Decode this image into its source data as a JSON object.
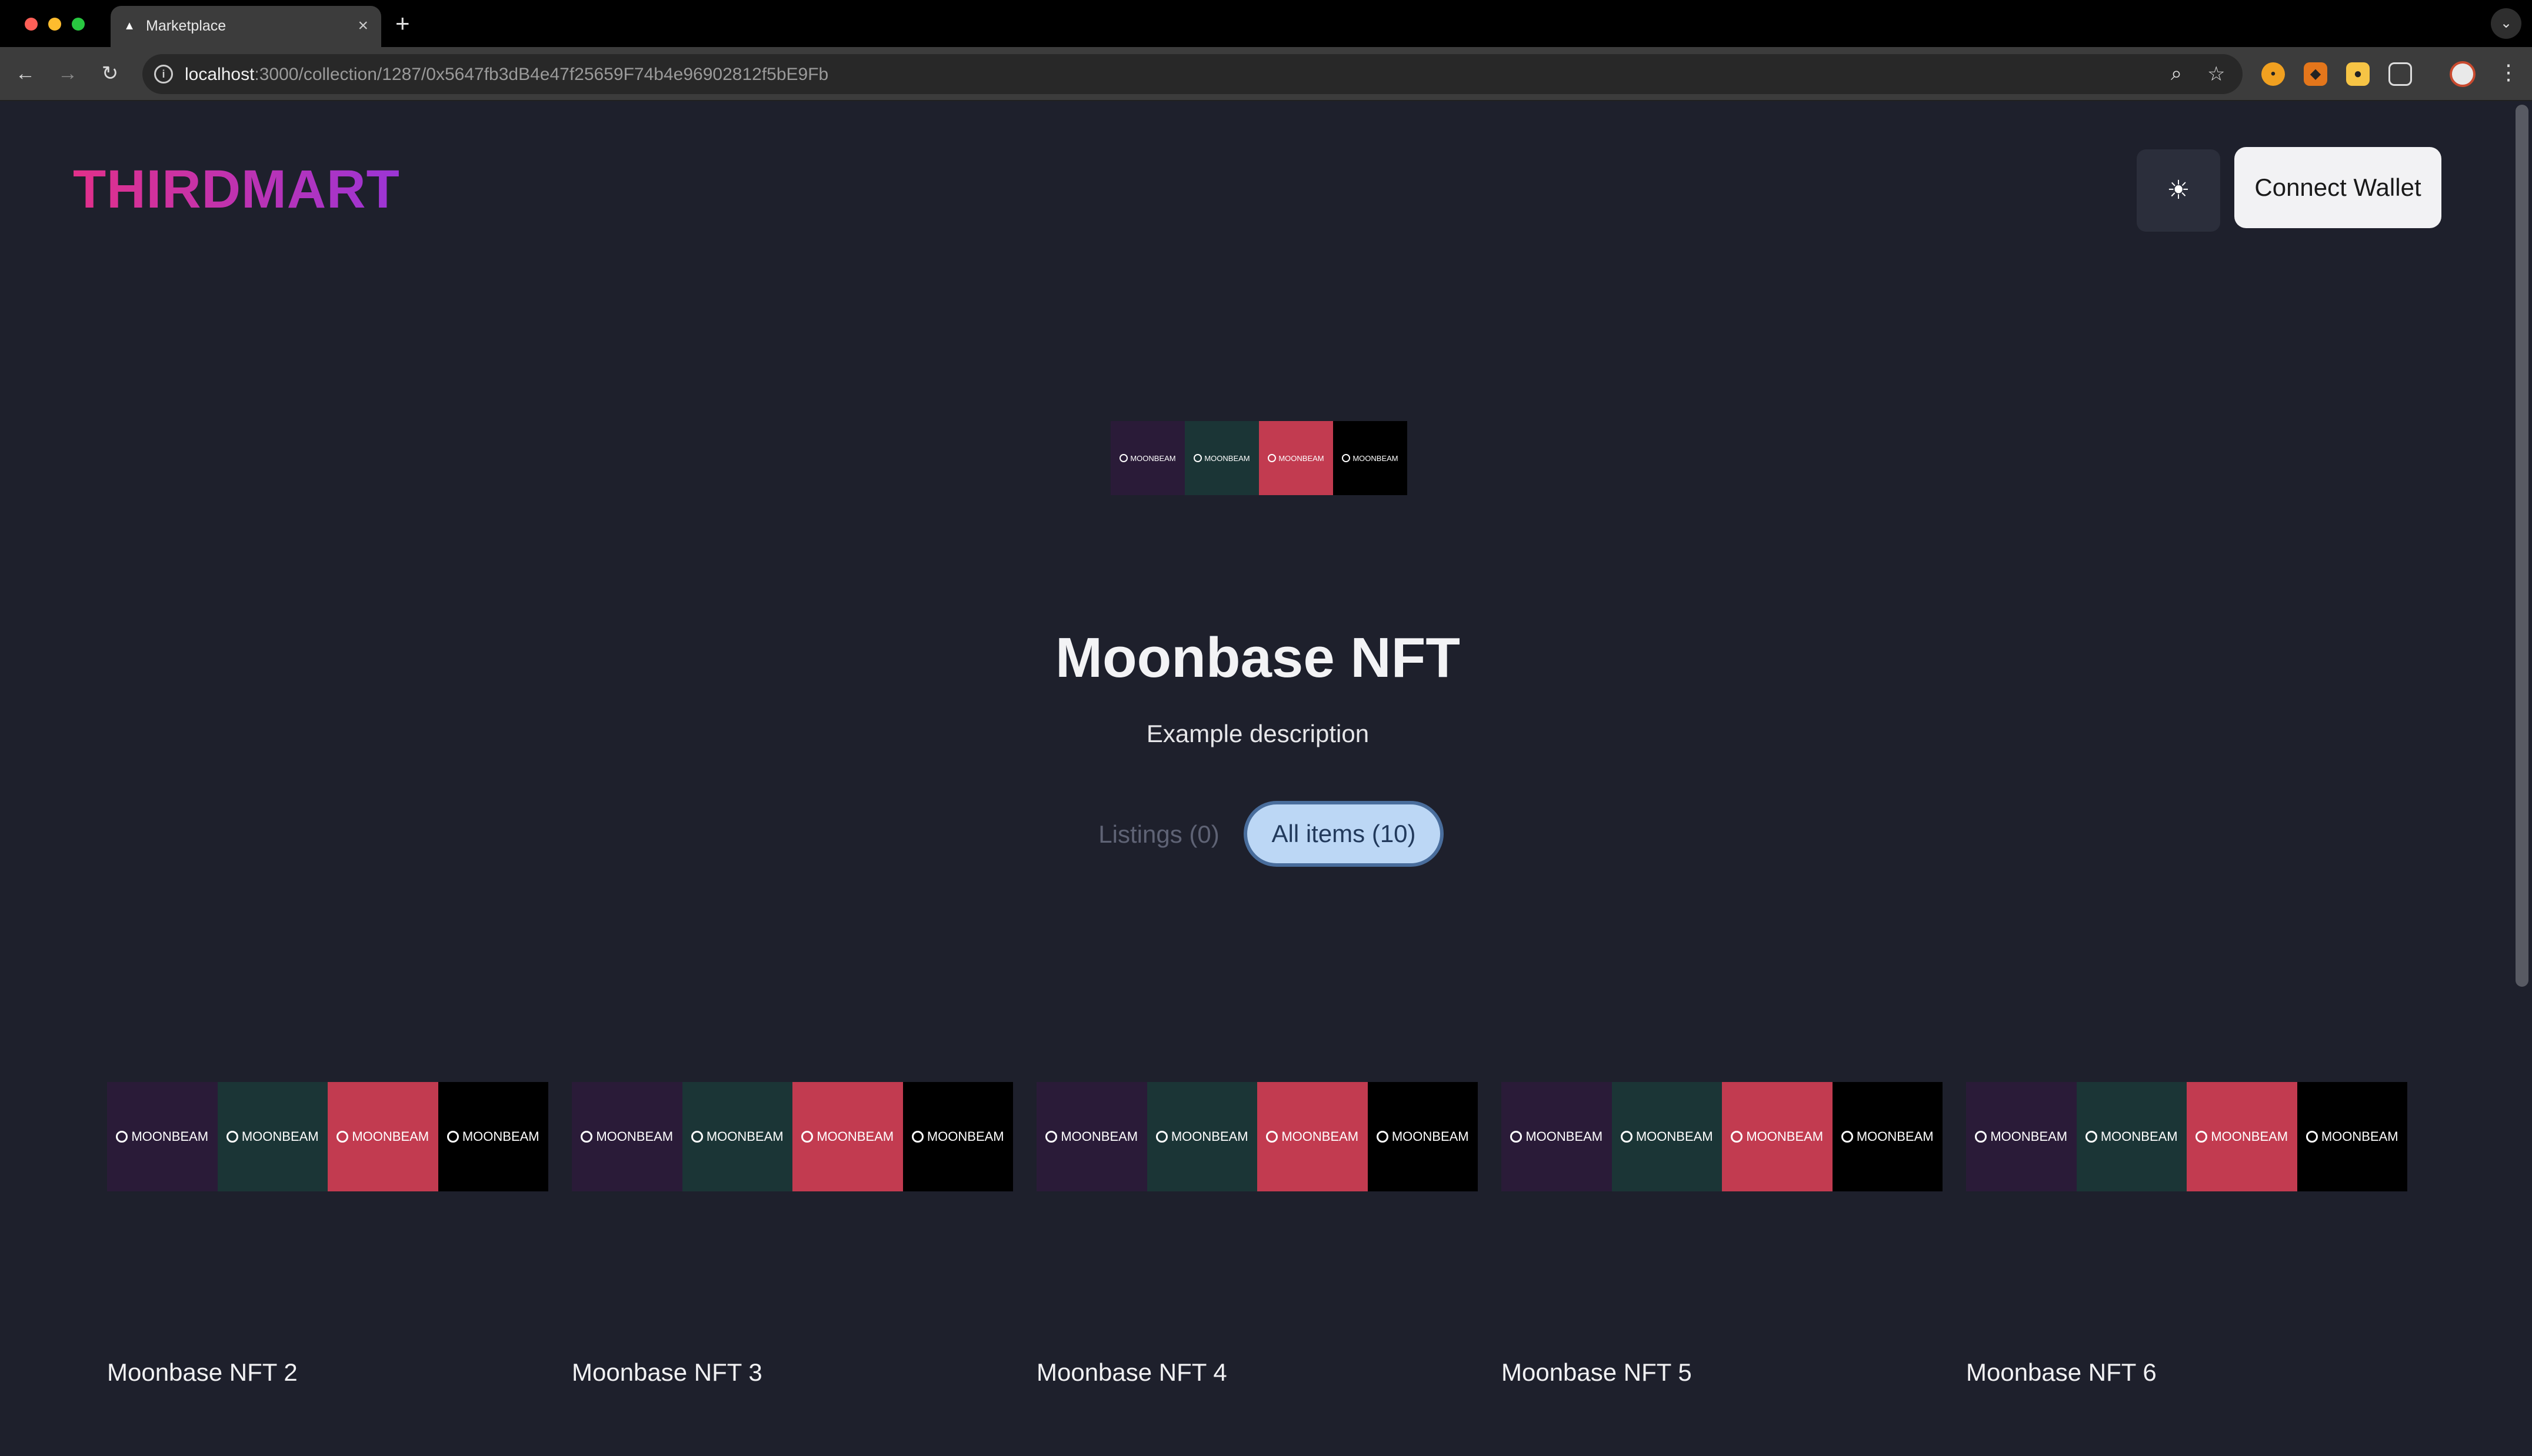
{
  "browser": {
    "tab_title": "Marketplace",
    "tab_favicon": "triangle-icon",
    "url_host": "localhost",
    "url_path": ":3000/collection/1287/0x5647fb3dB4e47f25659F74b4e96902812f5bE9Fb"
  },
  "header": {
    "logo": "THIRDMART",
    "theme_toggle_icon": "sun-icon",
    "connect_label": "Connect Wallet"
  },
  "banner": {
    "label": "MOONBEAM",
    "colors": [
      "#2a1b38",
      "#1b3536",
      "#c23b50",
      "#000000"
    ]
  },
  "collection": {
    "name": "Moonbase NFT",
    "description": "Example description"
  },
  "tabs": {
    "listings": "Listings (0)",
    "all_items": "All items (10)"
  },
  "items": [
    {
      "name": "Moonbase NFT 2"
    },
    {
      "name": "Moonbase NFT 3"
    },
    {
      "name": "Moonbase NFT 4"
    },
    {
      "name": "Moonbase NFT 5"
    },
    {
      "name": "Moonbase NFT 6"
    }
  ],
  "colors": {
    "page_bg": "#1e202c",
    "logo_gradient_start": "#e2308a",
    "logo_gradient_end": "#9b35d6",
    "active_tab_bg": "#bcd7f5"
  }
}
